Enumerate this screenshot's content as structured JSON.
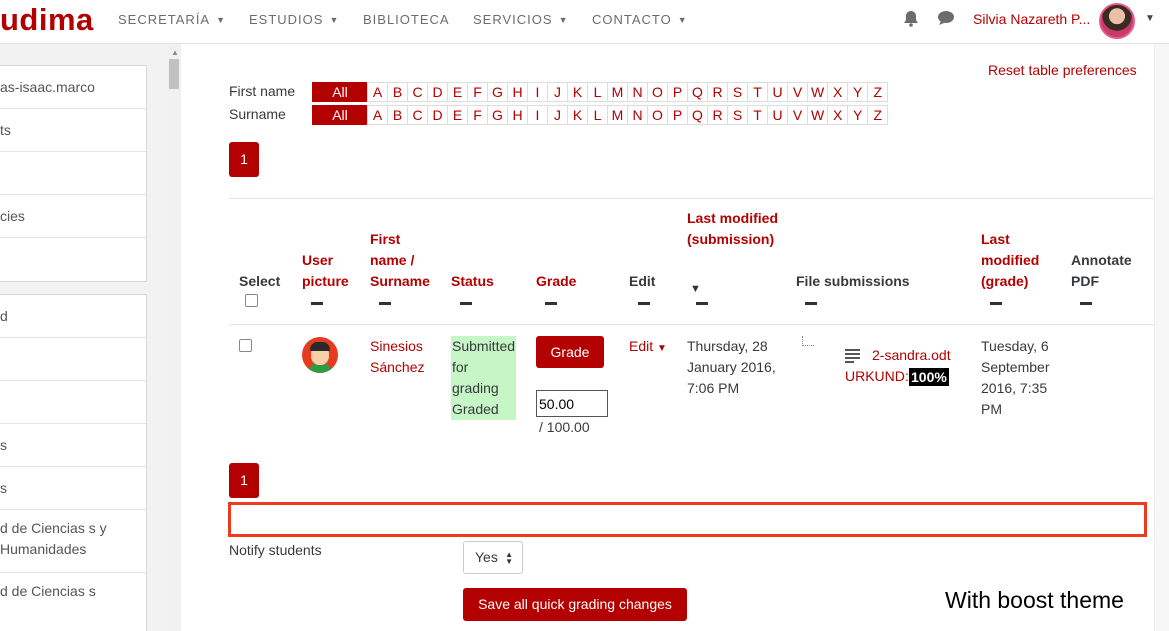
{
  "navbar": {
    "brand_red_prefix": "",
    "brand_text": "udima",
    "menu": [
      "SECRETARÍA",
      "ESTUDIOS",
      "BIBLIOTECA",
      "SERVICIOS",
      "CONTACTO"
    ],
    "user_name": "Silvia Nazareth P...",
    "icons": [
      "bell-icon",
      "chat-icon"
    ]
  },
  "drawer": {
    "group1": [
      "as-isaac.marco",
      "ts",
      "",
      "cies",
      ""
    ],
    "group2": [
      "d",
      "",
      "",
      "s",
      "s",
      "d de Ciencias s y Humanidades",
      "d de Ciencias s"
    ]
  },
  "filters": {
    "reset_label": "Reset table preferences",
    "first_name_label": "First name",
    "surname_label": "Surname",
    "all_label": "All",
    "letters": [
      "A",
      "B",
      "C",
      "D",
      "E",
      "F",
      "G",
      "H",
      "I",
      "J",
      "K",
      "L",
      "M",
      "N",
      "O",
      "P",
      "Q",
      "R",
      "S",
      "T",
      "U",
      "V",
      "W",
      "X",
      "Y",
      "Z"
    ]
  },
  "pagination": {
    "page": "1"
  },
  "table": {
    "headers": {
      "select": "Select",
      "user_picture": "User picture",
      "name": "First name / Surname",
      "status": "Status",
      "grade": "Grade",
      "edit": "Edit",
      "last_modified_submission": "Last modified (submission)",
      "file_submissions": "File submissions",
      "last_modified_grade": "Last modified (grade)",
      "annotate_pdf": "Annotate PDF"
    },
    "row": {
      "first_name": "Sinesios",
      "surname": "Sánchez",
      "status_line1": "Submitted for grading",
      "status_line2": "Graded",
      "grade_button": "Grade",
      "grade_value": "50.00",
      "grade_max": "/ 100.00",
      "edit_label": "Edit",
      "submission_date": "Thursday, 28 January 2016, 7:06 PM",
      "file_name": "2-sandra.odt",
      "urkund_label": "URKUND:",
      "urkund_score": "100%",
      "grade_date": "Tuesday, 6 September 2016, 7:35 PM"
    }
  },
  "footer": {
    "notify_label": "Notify students",
    "notify_value": "Yes",
    "save_label": "Save all quick grading changes",
    "note": "With boost theme"
  },
  "colors": {
    "accent": "#b30000",
    "highlight": "#ee3a1e",
    "status_bg": "#c6f5c6"
  }
}
